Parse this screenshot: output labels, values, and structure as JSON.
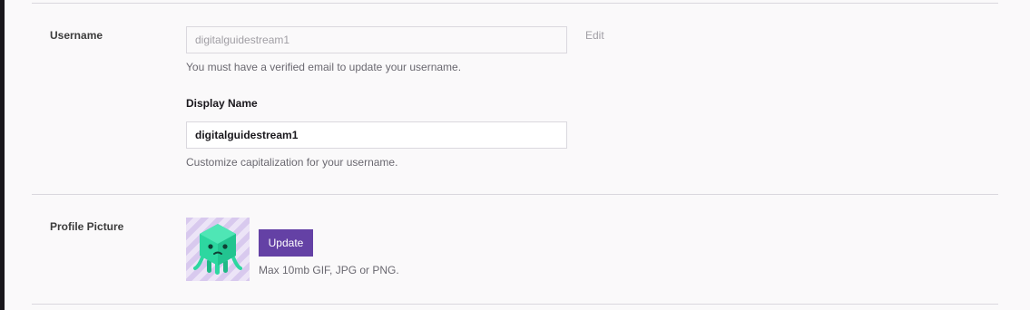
{
  "username": {
    "label": "Username",
    "value": "digitalguidestream1",
    "edit_label": "Edit",
    "help": "You must have a verified email to update your username."
  },
  "display_name": {
    "label": "Display Name",
    "value": "digitalguidestream1",
    "help": "Customize capitalization for your username."
  },
  "profile_picture": {
    "label": "Profile Picture",
    "update_label": "Update",
    "help": "Max 10mb GIF, JPG or PNG."
  },
  "colors": {
    "accent": "#6441a5",
    "background": "#faf9fa",
    "avatar_body": "#2dd7a0"
  }
}
